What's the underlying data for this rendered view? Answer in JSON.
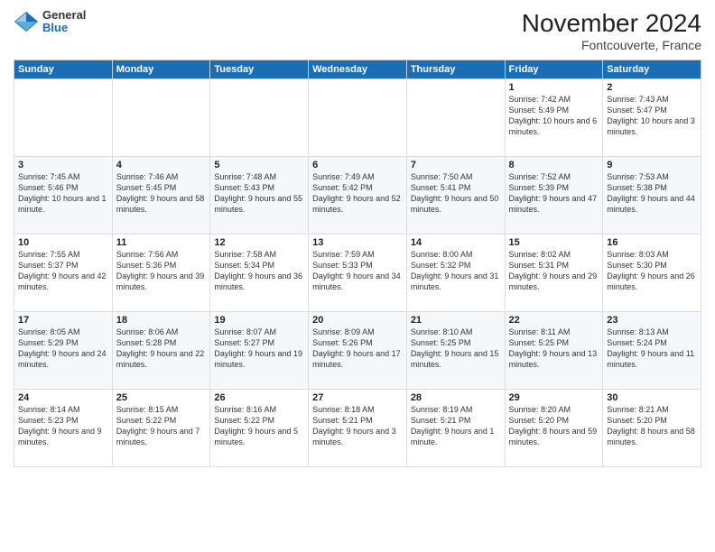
{
  "logo": {
    "line1": "General",
    "line2": "Blue"
  },
  "title": "November 2024",
  "location": "Fontcouverte, France",
  "weekdays": [
    "Sunday",
    "Monday",
    "Tuesday",
    "Wednesday",
    "Thursday",
    "Friday",
    "Saturday"
  ],
  "weeks": [
    [
      {
        "day": "",
        "info": ""
      },
      {
        "day": "",
        "info": ""
      },
      {
        "day": "",
        "info": ""
      },
      {
        "day": "",
        "info": ""
      },
      {
        "day": "",
        "info": ""
      },
      {
        "day": "1",
        "info": "Sunrise: 7:42 AM\nSunset: 5:49 PM\nDaylight: 10 hours and 6 minutes."
      },
      {
        "day": "2",
        "info": "Sunrise: 7:43 AM\nSunset: 5:47 PM\nDaylight: 10 hours and 3 minutes."
      }
    ],
    [
      {
        "day": "3",
        "info": "Sunrise: 7:45 AM\nSunset: 5:46 PM\nDaylight: 10 hours and 1 minute."
      },
      {
        "day": "4",
        "info": "Sunrise: 7:46 AM\nSunset: 5:45 PM\nDaylight: 9 hours and 58 minutes."
      },
      {
        "day": "5",
        "info": "Sunrise: 7:48 AM\nSunset: 5:43 PM\nDaylight: 9 hours and 55 minutes."
      },
      {
        "day": "6",
        "info": "Sunrise: 7:49 AM\nSunset: 5:42 PM\nDaylight: 9 hours and 52 minutes."
      },
      {
        "day": "7",
        "info": "Sunrise: 7:50 AM\nSunset: 5:41 PM\nDaylight: 9 hours and 50 minutes."
      },
      {
        "day": "8",
        "info": "Sunrise: 7:52 AM\nSunset: 5:39 PM\nDaylight: 9 hours and 47 minutes."
      },
      {
        "day": "9",
        "info": "Sunrise: 7:53 AM\nSunset: 5:38 PM\nDaylight: 9 hours and 44 minutes."
      }
    ],
    [
      {
        "day": "10",
        "info": "Sunrise: 7:55 AM\nSunset: 5:37 PM\nDaylight: 9 hours and 42 minutes."
      },
      {
        "day": "11",
        "info": "Sunrise: 7:56 AM\nSunset: 5:36 PM\nDaylight: 9 hours and 39 minutes."
      },
      {
        "day": "12",
        "info": "Sunrise: 7:58 AM\nSunset: 5:34 PM\nDaylight: 9 hours and 36 minutes."
      },
      {
        "day": "13",
        "info": "Sunrise: 7:59 AM\nSunset: 5:33 PM\nDaylight: 9 hours and 34 minutes."
      },
      {
        "day": "14",
        "info": "Sunrise: 8:00 AM\nSunset: 5:32 PM\nDaylight: 9 hours and 31 minutes."
      },
      {
        "day": "15",
        "info": "Sunrise: 8:02 AM\nSunset: 5:31 PM\nDaylight: 9 hours and 29 minutes."
      },
      {
        "day": "16",
        "info": "Sunrise: 8:03 AM\nSunset: 5:30 PM\nDaylight: 9 hours and 26 minutes."
      }
    ],
    [
      {
        "day": "17",
        "info": "Sunrise: 8:05 AM\nSunset: 5:29 PM\nDaylight: 9 hours and 24 minutes."
      },
      {
        "day": "18",
        "info": "Sunrise: 8:06 AM\nSunset: 5:28 PM\nDaylight: 9 hours and 22 minutes."
      },
      {
        "day": "19",
        "info": "Sunrise: 8:07 AM\nSunset: 5:27 PM\nDaylight: 9 hours and 19 minutes."
      },
      {
        "day": "20",
        "info": "Sunrise: 8:09 AM\nSunset: 5:26 PM\nDaylight: 9 hours and 17 minutes."
      },
      {
        "day": "21",
        "info": "Sunrise: 8:10 AM\nSunset: 5:25 PM\nDaylight: 9 hours and 15 minutes."
      },
      {
        "day": "22",
        "info": "Sunrise: 8:11 AM\nSunset: 5:25 PM\nDaylight: 9 hours and 13 minutes."
      },
      {
        "day": "23",
        "info": "Sunrise: 8:13 AM\nSunset: 5:24 PM\nDaylight: 9 hours and 11 minutes."
      }
    ],
    [
      {
        "day": "24",
        "info": "Sunrise: 8:14 AM\nSunset: 5:23 PM\nDaylight: 9 hours and 9 minutes."
      },
      {
        "day": "25",
        "info": "Sunrise: 8:15 AM\nSunset: 5:22 PM\nDaylight: 9 hours and 7 minutes."
      },
      {
        "day": "26",
        "info": "Sunrise: 8:16 AM\nSunset: 5:22 PM\nDaylight: 9 hours and 5 minutes."
      },
      {
        "day": "27",
        "info": "Sunrise: 8:18 AM\nSunset: 5:21 PM\nDaylight: 9 hours and 3 minutes."
      },
      {
        "day": "28",
        "info": "Sunrise: 8:19 AM\nSunset: 5:21 PM\nDaylight: 9 hours and 1 minute."
      },
      {
        "day": "29",
        "info": "Sunrise: 8:20 AM\nSunset: 5:20 PM\nDaylight: 8 hours and 59 minutes."
      },
      {
        "day": "30",
        "info": "Sunrise: 8:21 AM\nSunset: 5:20 PM\nDaylight: 8 hours and 58 minutes."
      }
    ]
  ]
}
